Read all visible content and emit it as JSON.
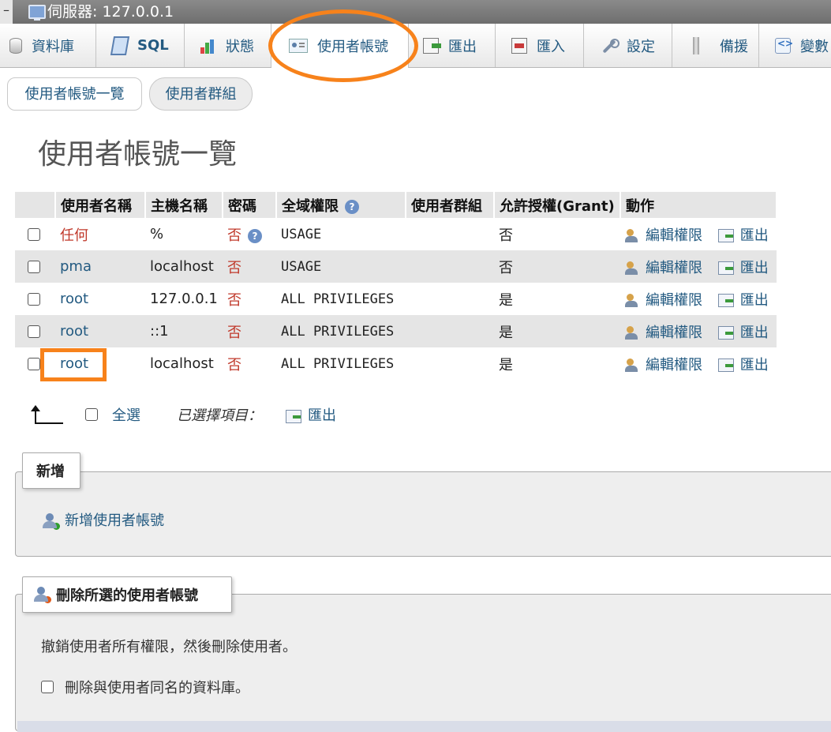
{
  "window": {
    "title": "伺服器: 127.0.0.1"
  },
  "tabs": [
    {
      "label": "資料庫",
      "icon": "database-icon"
    },
    {
      "label": "SQL",
      "icon": "sql-icon"
    },
    {
      "label": "狀態",
      "icon": "status-icon"
    },
    {
      "label": "使用者帳號",
      "icon": "user-accounts-icon",
      "active": true
    },
    {
      "label": "匯出",
      "icon": "export-icon"
    },
    {
      "label": "匯入",
      "icon": "import-icon"
    },
    {
      "label": "設定",
      "icon": "wrench-icon"
    },
    {
      "label": "備援",
      "icon": "replication-icon"
    },
    {
      "label": "變數",
      "icon": "variables-icon"
    }
  ],
  "subtabs": [
    {
      "label": "使用者帳號一覽"
    },
    {
      "label": "使用者群組"
    }
  ],
  "page_title": "使用者帳號一覽",
  "table": {
    "headers": [
      "使用者名稱",
      "主機名稱",
      "密碼",
      "全域權限",
      "使用者群組",
      "允許授權(Grant)",
      "動作"
    ],
    "rows": [
      {
        "user": "任何",
        "host": "%",
        "password": "否",
        "privileges": "USAGE",
        "group": "",
        "grant": "否",
        "edit": "編輯權限",
        "export": "匯出"
      },
      {
        "user": "pma",
        "host": "localhost",
        "password": "否",
        "privileges": "USAGE",
        "group": "",
        "grant": "否",
        "edit": "編輯權限",
        "export": "匯出"
      },
      {
        "user": "root",
        "host": "127.0.0.1",
        "password": "否",
        "privileges": "ALL PRIVILEGES",
        "group": "",
        "grant": "是",
        "edit": "編輯權限",
        "export": "匯出"
      },
      {
        "user": "root",
        "host": "::1",
        "password": "否",
        "privileges": "ALL PRIVILEGES",
        "group": "",
        "grant": "是",
        "edit": "編輯權限",
        "export": "匯出"
      },
      {
        "user": "root",
        "host": "localhost",
        "password": "否",
        "privileges": "ALL PRIVILEGES",
        "group": "",
        "grant": "是",
        "edit": "編輯權限",
        "export": "匯出"
      }
    ]
  },
  "with_selected": {
    "select_all": "全選",
    "label": "已選擇項目：",
    "export": "匯出"
  },
  "new_section": {
    "legend": "新增",
    "add_user": "新增使用者帳號"
  },
  "delete_section": {
    "legend": "刪除所選的使用者帳號",
    "description": "撤銷使用者所有權限，然後刪除使用者。",
    "drop_db_label": "刪除與使用者同名的資料庫。"
  },
  "colors": {
    "link": "#235a81",
    "annotation": "#f7821b",
    "no_password": "#c0392b"
  }
}
